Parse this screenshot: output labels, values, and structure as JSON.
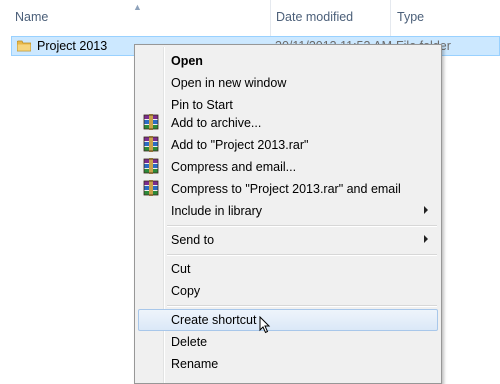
{
  "columns": {
    "name": "Name",
    "date_modified": "Date modified",
    "type": "Type"
  },
  "file": {
    "name": "Project 2013",
    "date_modified": "30/11/2013 11:53 AM",
    "type": "File folder"
  },
  "context_menu": {
    "open": "Open",
    "open_new_window": "Open in new window",
    "pin_to_start": "Pin to Start",
    "add_to_archive": "Add to archive...",
    "add_to_rar": "Add to \"Project 2013.rar\"",
    "compress_email": "Compress and email...",
    "compress_rar_email": "Compress to \"Project 2013.rar\" and email",
    "include_in_library": "Include in library",
    "send_to": "Send to",
    "cut": "Cut",
    "copy": "Copy",
    "create_shortcut": "Create shortcut",
    "delete": "Delete",
    "rename": "Rename"
  },
  "icons": {
    "folder": "folder-icon",
    "archive": "winrar-archive-icon",
    "submenu": "submenu-arrow-icon",
    "cursor": "mouse-cursor-icon"
  },
  "colors": {
    "selection_bg": "#cce8ff",
    "selection_border": "#99d1ff",
    "menu_bg": "#f0f0f0",
    "hover_border": "#a8c7ea"
  }
}
